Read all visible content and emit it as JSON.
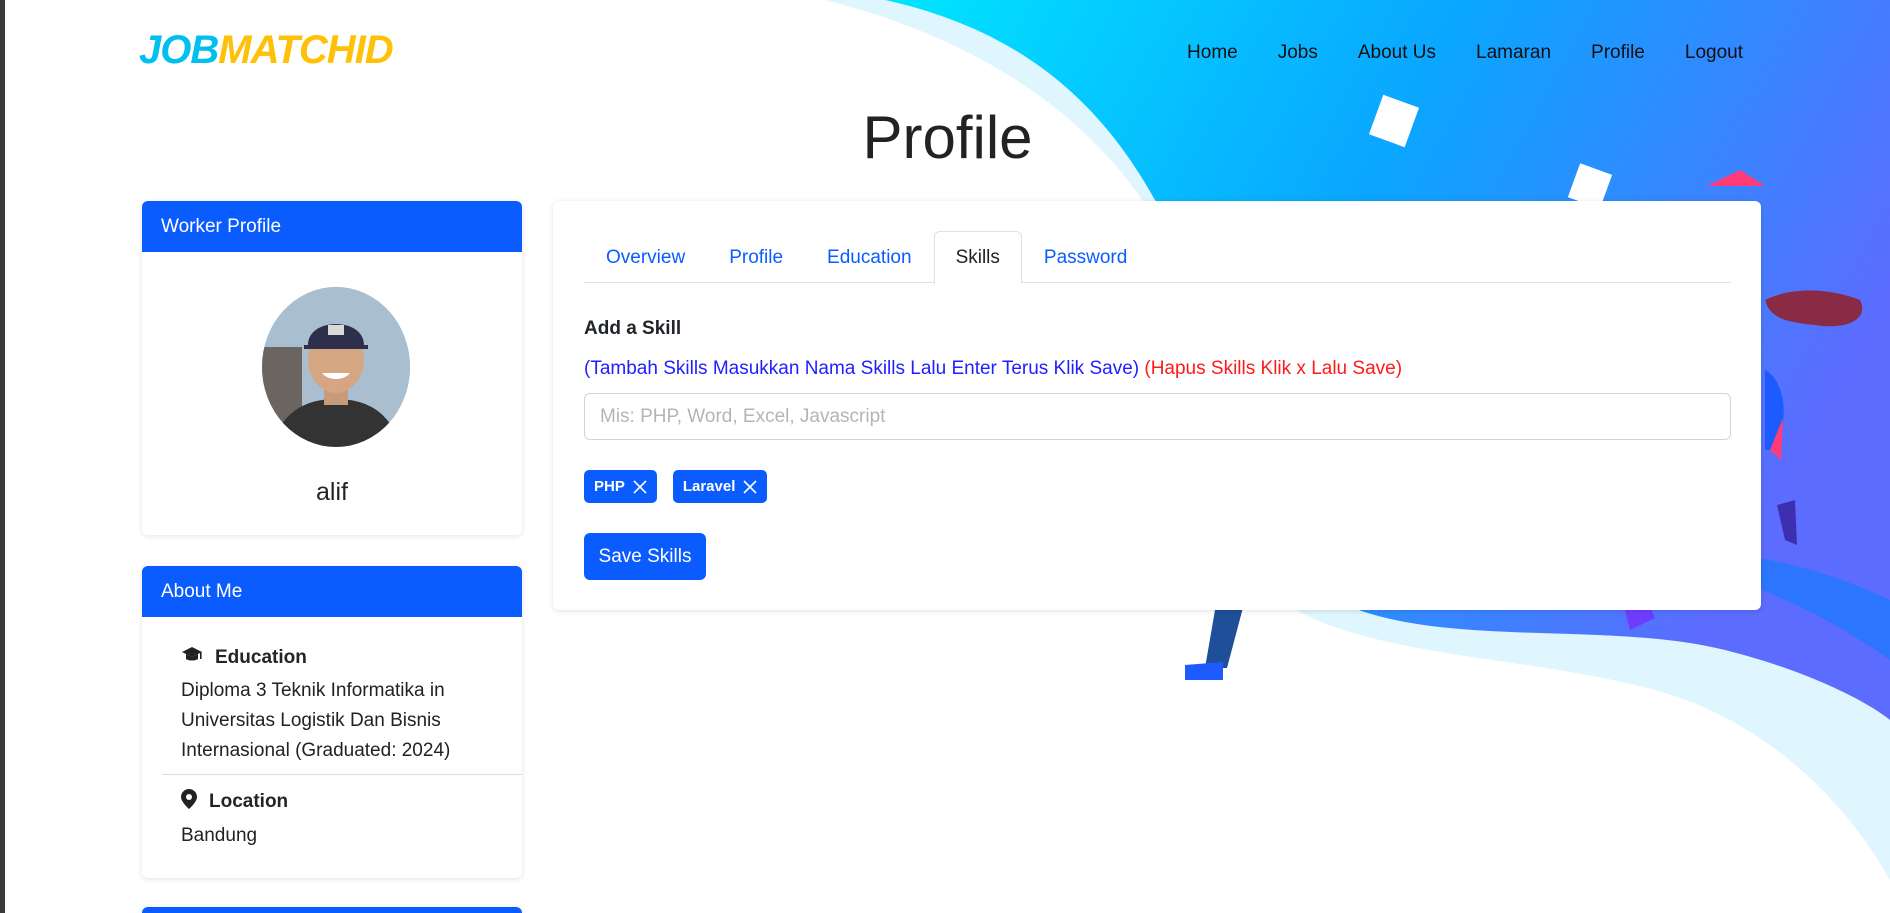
{
  "brand": {
    "part1": "JOB",
    "part2": "MATCHID"
  },
  "nav": [
    "Home",
    "Jobs",
    "About Us",
    "Lamaran",
    "Profile",
    "Logout"
  ],
  "page_title": "Profile",
  "worker_card": {
    "header": "Worker Profile",
    "name": "alif"
  },
  "about_card": {
    "header": "About Me",
    "education_label": "Education",
    "education_lines": [
      "Diploma 3 Teknik Informatika in",
      "Universitas Logistik Dan Bisnis",
      "Internasional (Graduated: 2024)"
    ],
    "location_label": "Location",
    "location_value": "Bandung"
  },
  "tabs": [
    "Overview",
    "Profile",
    "Education",
    "Skills",
    "Password"
  ],
  "active_tab": "Skills",
  "skills": {
    "add_label": "Add a Skill",
    "hint_add": "(Tambah Skills Masukkan Nama Skills Lalu Enter Terus Klik Save)",
    "hint_remove": "(Hapus Skills Klik x Lalu Save)",
    "input_placeholder": "Mis: PHP, Word, Excel, Javascript",
    "input_value": "",
    "tags": [
      "PHP",
      "Laravel"
    ],
    "save_label": "Save Skills"
  },
  "colors": {
    "primary": "#0b5cff",
    "brand_cyan": "#00c0f0",
    "brand_yellow": "#ffc107",
    "hint_blue": "#1f1fff",
    "hint_red": "#ff1a1a"
  }
}
